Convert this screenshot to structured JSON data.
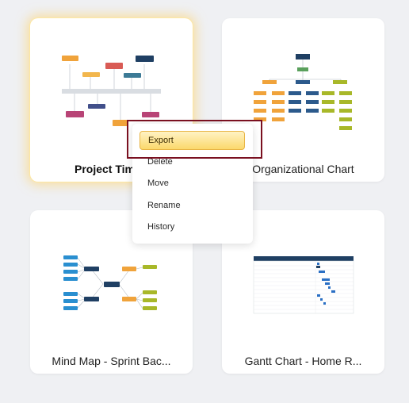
{
  "cards": [
    {
      "title": "Project Timel",
      "selected": true
    },
    {
      "title": "Organizational Chart"
    },
    {
      "title": "Mind Map - Sprint Bac..."
    },
    {
      "title": "Gantt Chart - Home R..."
    }
  ],
  "context_menu": {
    "items": [
      {
        "label": "Export",
        "highlighted": true
      },
      {
        "label": "Delete"
      },
      {
        "label": "Move"
      },
      {
        "label": "Rename"
      },
      {
        "label": "History"
      }
    ]
  },
  "colors": {
    "background": "#eff0f3",
    "selection_glow": "#ffcd5a",
    "export_highlight": "#fbd86c",
    "annotation_box": "#7a1020"
  }
}
